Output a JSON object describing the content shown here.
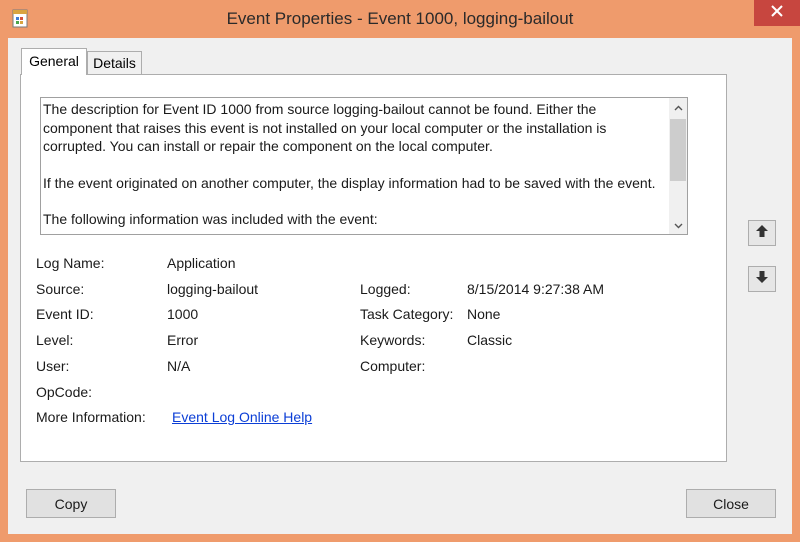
{
  "window": {
    "title": "Event Properties - Event 1000, logging-bailout"
  },
  "tabs": [
    {
      "label": "General",
      "selected": true
    },
    {
      "label": "Details",
      "selected": false
    }
  ],
  "description": {
    "paragraph1": "The description for Event ID 1000 from source logging-bailout cannot be found. Either the component that raises this event is not installed on your local computer or the installation is corrupted. You can install or repair the component on the local computer.",
    "paragraph2": "If the event originated on another computer, the display information had to be saved with the event.",
    "paragraph3": "The following information was included with the event:"
  },
  "fields": {
    "log_name_label": "Log Name:",
    "log_name_value": "Application",
    "source_label": "Source:",
    "source_value": "logging-bailout",
    "logged_label": "Logged:",
    "logged_value": "8/15/2014 9:27:38 AM",
    "event_id_label": "Event ID:",
    "event_id_value": "1000",
    "task_category_label": "Task Category:",
    "task_category_value": "None",
    "level_label": "Level:",
    "level_value": "Error",
    "keywords_label": "Keywords:",
    "keywords_value": "Classic",
    "user_label": "User:",
    "user_value": "N/A",
    "computer_label": "Computer:",
    "opcode_label": "OpCode:",
    "more_info_label": "More Information:",
    "more_info_link": "Event Log Online Help"
  },
  "buttons": {
    "copy": "Copy",
    "close": "Close"
  },
  "icons": {
    "app": "event-viewer-icon",
    "close": "close-icon",
    "up": "arrow-up-icon",
    "down": "arrow-down-icon"
  },
  "colors": {
    "frame": "#ef9b6c",
    "close_button": "#c7463f",
    "link": "#0b3ed6"
  }
}
